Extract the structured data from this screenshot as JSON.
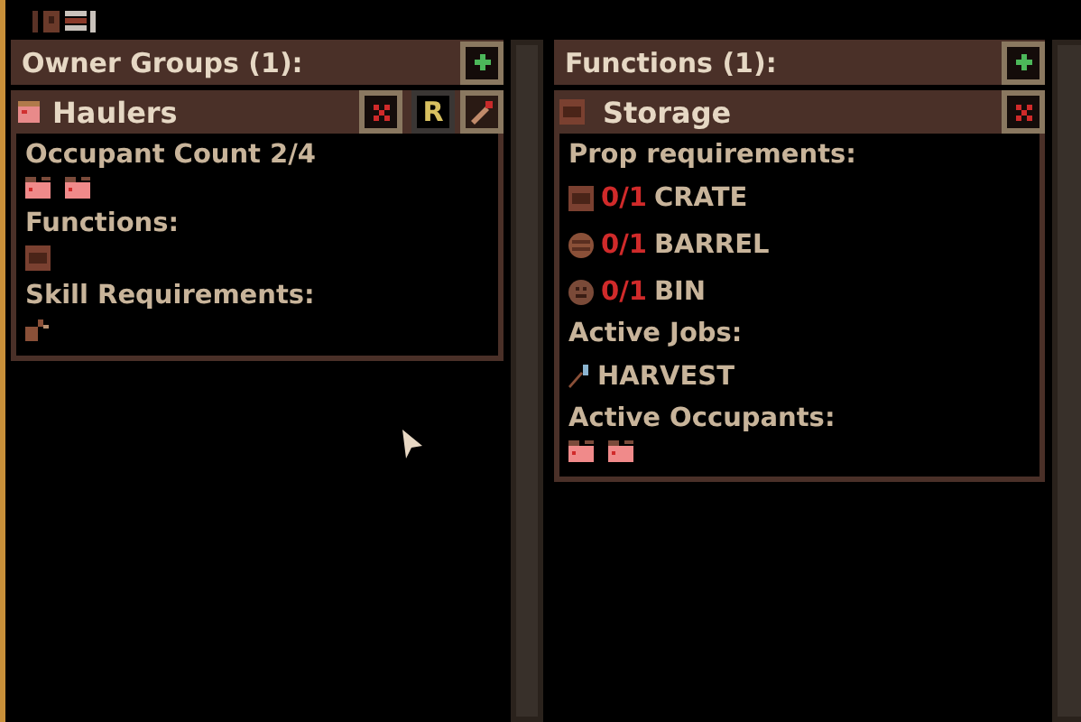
{
  "owner_groups": {
    "title": "Owner Groups (1):",
    "groups": [
      {
        "name": "Haulers",
        "reserve_label": "R",
        "occupant_count": "Occupant Count 2/4",
        "occupants": [
          {
            "kind": "person"
          },
          {
            "kind": "person"
          }
        ],
        "functions_label": "Functions:",
        "functions": [
          {
            "kind": "crate"
          }
        ],
        "skills_label": "Skill Requirements:",
        "skills": [
          {
            "kind": "tool"
          }
        ]
      }
    ]
  },
  "functions": {
    "title": "Functions (1):",
    "items": [
      {
        "name": "Storage",
        "kind": "crate",
        "props_label": "Prop requirements:",
        "props": [
          {
            "kind": "crate",
            "count": "0/1",
            "met": false,
            "name": "CRATE"
          },
          {
            "kind": "barrel",
            "count": "0/1",
            "met": false,
            "name": "BARREL"
          },
          {
            "kind": "bin",
            "count": "0/1",
            "met": false,
            "name": "BIN"
          }
        ],
        "jobs_label": "Active Jobs:",
        "jobs": [
          {
            "kind": "pick",
            "name": "HARVEST"
          }
        ],
        "occupants_label": "Active Occupants:",
        "occupants": [
          {
            "kind": "person"
          },
          {
            "kind": "person"
          }
        ]
      }
    ]
  }
}
